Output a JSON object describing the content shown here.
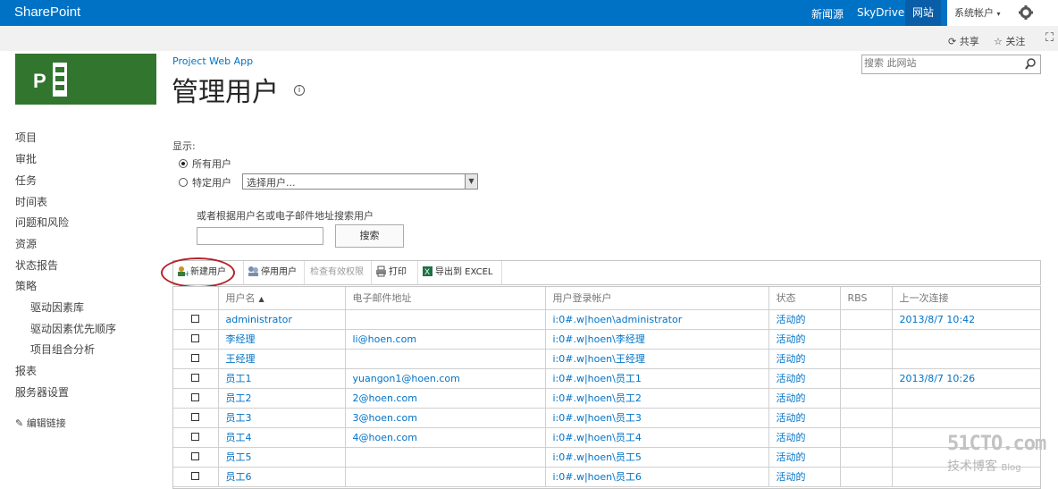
{
  "suite": {
    "brand": "SharePoint",
    "links": [
      "新闻源",
      "SkyDrive",
      "网站"
    ],
    "user": "系统帐户",
    "gear_icon": "gear-icon",
    "help_icon": "focus-icon"
  },
  "ribbon": {
    "share": "共享",
    "follow": "关注"
  },
  "breadcrumb": "Project Web App",
  "page_title": "管理用户",
  "search": {
    "placeholder": "搜索 此网站"
  },
  "nav": {
    "items": [
      "项目",
      "审批",
      "任务",
      "时间表",
      "问题和风险",
      "资源",
      "状态报告",
      "策略"
    ],
    "sub_items": [
      "驱动因素库",
      "驱动因素优先顺序",
      "项目组合分析"
    ],
    "items2": [
      "报表",
      "服务器设置"
    ],
    "edit_links": "编辑链接"
  },
  "filter": {
    "show_label": "显示:",
    "all_users": "所有用户",
    "specific_user": "特定用户",
    "select_placeholder": "选择用户...",
    "search_hint": "或者根据用户名或电子邮件地址搜索用户",
    "search_button": "搜索"
  },
  "toolbar": {
    "new_user": "新建用户",
    "disable_user": "停用用户",
    "check_permissions": "检查有效权限",
    "print": "打印",
    "export_excel": "导出到 EXCEL"
  },
  "grid": {
    "columns": [
      "用户名",
      "电子邮件地址",
      "用户登录帐户",
      "状态",
      "RBS",
      "上一次连接"
    ],
    "rows": [
      {
        "name": "administrator",
        "email": "",
        "account": "i:0#.w|hoen\\administrator",
        "status": "活动的",
        "rbs": "",
        "last": "2013/8/7 10:42"
      },
      {
        "name": "李经理",
        "email": "li@hoen.com",
        "account": "i:0#.w|hoen\\李经理",
        "status": "活动的",
        "rbs": "",
        "last": ""
      },
      {
        "name": "王经理",
        "email": "",
        "account": "i:0#.w|hoen\\王经理",
        "status": "活动的",
        "rbs": "",
        "last": ""
      },
      {
        "name": "员工1",
        "email": "yuangon1@hoen.com",
        "account": "i:0#.w|hoen\\员工1",
        "status": "活动的",
        "rbs": "",
        "last": "2013/8/7 10:26"
      },
      {
        "name": "员工2",
        "email": "2@hoen.com",
        "account": "i:0#.w|hoen\\员工2",
        "status": "活动的",
        "rbs": "",
        "last": ""
      },
      {
        "name": "员工3",
        "email": "3@hoen.com",
        "account": "i:0#.w|hoen\\员工3",
        "status": "活动的",
        "rbs": "",
        "last": ""
      },
      {
        "name": "员工4",
        "email": "4@hoen.com",
        "account": "i:0#.w|hoen\\员工4",
        "status": "活动的",
        "rbs": "",
        "last": ""
      },
      {
        "name": "员工5",
        "email": "",
        "account": "i:0#.w|hoen\\员工5",
        "status": "活动的",
        "rbs": "",
        "last": ""
      },
      {
        "name": "员工6",
        "email": "",
        "account": "i:0#.w|hoen\\员工6",
        "status": "活动的",
        "rbs": "",
        "last": ""
      }
    ]
  },
  "watermark": {
    "site": "51CTO.com",
    "line2": "技术博客",
    "line3": "Blog"
  },
  "colors": {
    "suite_blue": "#0072c6",
    "logo_green": "#31752f",
    "link_blue": "#0072c6",
    "ring_red": "#b4232a"
  }
}
